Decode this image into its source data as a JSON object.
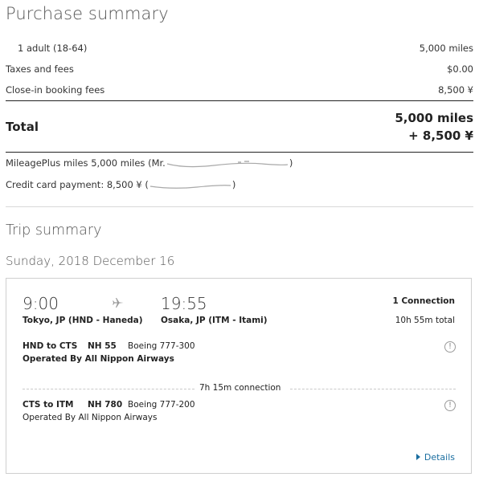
{
  "purchase": {
    "title": "Purchase summary",
    "rows": [
      {
        "label": "1 adult (18-64)",
        "value": "5,000 miles"
      },
      {
        "label": "Taxes and fees",
        "value": "$0.00"
      },
      {
        "label": "Close-in booking fees",
        "value": "8,500 ¥"
      }
    ],
    "total_label": "Total",
    "total_miles": "5,000 miles",
    "total_yen": "+ 8,500 ¥",
    "mileageplus_prefix": "MileagePlus miles 5,000 miles (Mr.",
    "mileageplus_suffix": ")",
    "credit_prefix": "Credit card payment: 8,500 ¥ (",
    "credit_suffix": ")"
  },
  "trip": {
    "title": "Trip summary",
    "date": "Sunday, 2018 December 16",
    "depart_time": "9:00",
    "arrive_time": "19:55",
    "depart_city": "Tokyo, JP (HND - Haneda)",
    "arrive_city": "Osaka, JP (ITM - Itami)",
    "connections": "1 Connection",
    "duration": "10h 55m total",
    "segments": [
      {
        "route": "HND to CTS",
        "flight": "NH 55",
        "aircraft": "Boeing 777-300",
        "operated": "Operated By All Nippon Airways"
      },
      {
        "route": "CTS to ITM",
        "flight": "NH 780",
        "aircraft": "Boeing 777-200",
        "operated": "Operated By All Nippon Airways"
      }
    ],
    "connection_time": "7h 15m connection",
    "details_label": "Details"
  },
  "icons": {
    "plane": "airplane-icon",
    "info": "info-icon",
    "details": "triangle-right-icon"
  },
  "colors": {
    "link": "#1a6ea0",
    "text": "#333333"
  }
}
